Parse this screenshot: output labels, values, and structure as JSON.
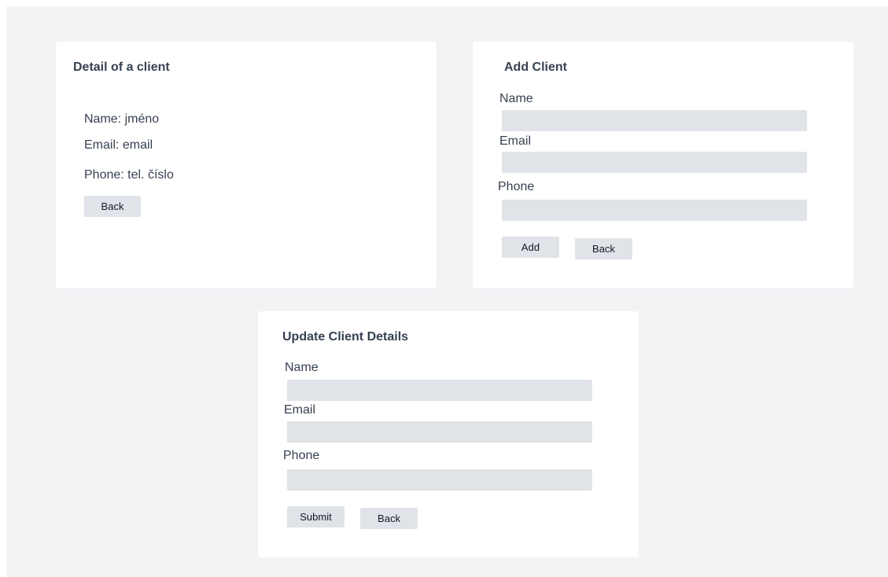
{
  "detail_card": {
    "title": "Detail of a client",
    "name_line": "Name: jméno",
    "email_line": "Email: email",
    "phone_line": "Phone: tel. číslo",
    "back_label": "Back"
  },
  "add_card": {
    "title": "Add Client",
    "name_label": "Name",
    "email_label": "Email",
    "phone_label": "Phone",
    "name_value": "",
    "email_value": "",
    "phone_value": "",
    "add_label": "Add",
    "back_label": "Back"
  },
  "update_card": {
    "title": "Update Client Details",
    "name_label": "Name",
    "email_label": "Email",
    "phone_label": "Phone",
    "name_value": "",
    "email_value": "",
    "phone_value": "",
    "submit_label": "Submit",
    "back_label": "Back"
  }
}
